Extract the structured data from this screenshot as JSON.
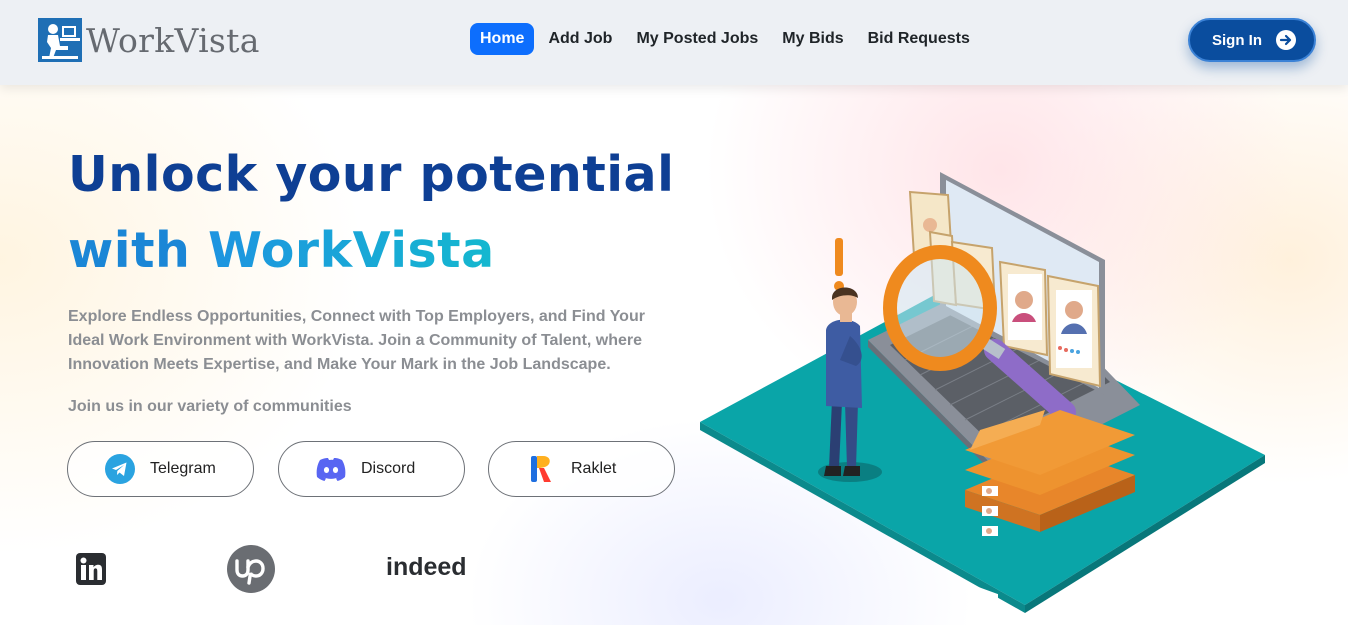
{
  "brand": {
    "name": "WorkVista"
  },
  "nav": {
    "items": [
      {
        "label": "Home",
        "active": true
      },
      {
        "label": "Add Job",
        "active": false
      },
      {
        "label": "My Posted Jobs",
        "active": false
      },
      {
        "label": "My Bids",
        "active": false
      },
      {
        "label": "Bid Requests",
        "active": false
      }
    ],
    "signin_label": "Sign In"
  },
  "hero": {
    "title_line1": "Unlock your potential",
    "title_with": "with",
    "title_brand": "WorkVista",
    "description": "Explore Endless Opportunities, Connect with Top Employers, and Find Your Ideal Work Environment with WorkVista. Join a Community of Talent, where Innovation Meets Expertise, and Make Your Mark in the Job Landscape.",
    "join_text": "Join us in our variety of communities"
  },
  "communities": [
    {
      "label": "Telegram",
      "icon": "telegram-icon",
      "color": "#2aa3e0"
    },
    {
      "label": "Discord",
      "icon": "discord-icon",
      "color": "#5865f2"
    },
    {
      "label": "Raklet",
      "icon": "raklet-icon",
      "color": "#ff5b2e"
    }
  ],
  "partners": [
    {
      "icon": "linkedin-icon"
    },
    {
      "icon": "upwork-icon"
    },
    {
      "name": "indeed",
      "icon": "indeed-logo"
    }
  ],
  "colors": {
    "nav_bg": "#edf0f4",
    "active_nav": "#0d6efd",
    "signin_bg": "#0a4d9e",
    "title_dark_blue": "#0e3f94",
    "title_light_blue": "#1a86d6",
    "text_gray": "#8b8e93"
  }
}
